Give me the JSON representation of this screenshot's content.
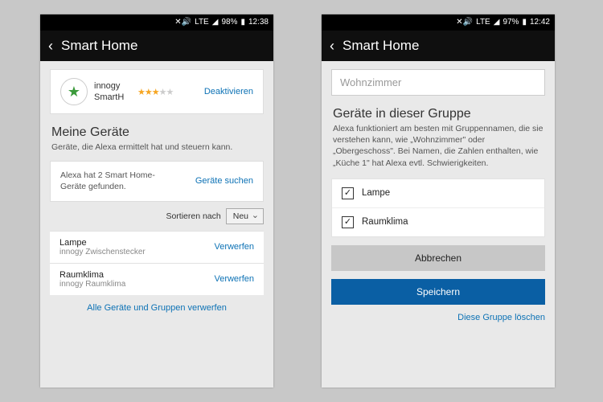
{
  "left": {
    "status": {
      "net": "LTE",
      "signal": "▲",
      "battery_pct": "98%",
      "time": "12:38",
      "mute_icon": "🔇"
    },
    "header": {
      "title": "Smart Home"
    },
    "skill": {
      "name_l1": "innogy",
      "name_l2": "SmartH",
      "action": "Deaktivieren",
      "rating": 3.5
    },
    "section": {
      "title": "Meine Geräte",
      "subtitle": "Geräte, die Alexa ermittelt hat und steuern kann."
    },
    "info": {
      "text": "Alexa hat 2 Smart Home-Geräte gefunden.",
      "action": "Geräte suchen"
    },
    "sort": {
      "label": "Sortieren nach",
      "value": "Neu"
    },
    "devices": [
      {
        "name": "Lampe",
        "sub": "innogy Zwischenstecker",
        "action": "Verwerfen"
      },
      {
        "name": "Raumklima",
        "sub": "innogy Raumklima",
        "action": "Verwerfen"
      }
    ],
    "footer": "Alle Geräte und Gruppen verwerfen"
  },
  "right": {
    "status": {
      "net": "LTE",
      "signal": "▲",
      "battery_pct": "97%",
      "time": "12:42",
      "mute_icon": "🔇"
    },
    "header": {
      "title": "Smart Home"
    },
    "input": {
      "value": "Wohnzimmer"
    },
    "section": {
      "title": "Geräte in dieser Gruppe",
      "subtitle": "Alexa funktioniert am besten mit Gruppennamen, die sie verstehen kann, wie „Wohnzimmer\" oder „Obergeschoss\". Bei Namen, die Zahlen enthalten, wie „Küche 1\" hat Alexa evtl. Schwierigkeiten."
    },
    "items": [
      {
        "label": "Lampe",
        "checked": true
      },
      {
        "label": "Raumklima",
        "checked": true
      }
    ],
    "buttons": {
      "cancel": "Abbrechen",
      "save": "Speichern"
    },
    "delete": "Diese Gruppe löschen"
  }
}
